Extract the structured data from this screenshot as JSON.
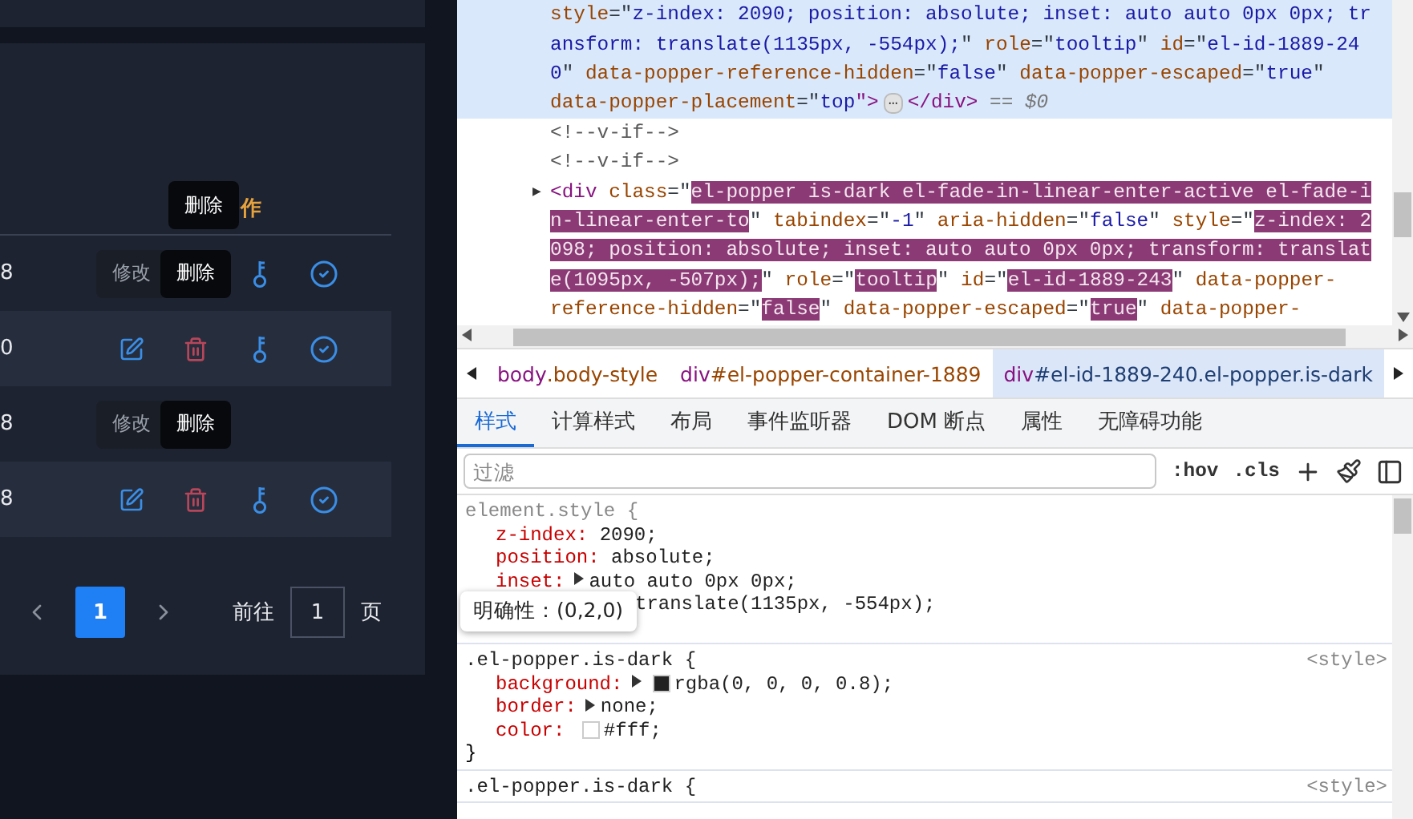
{
  "app": {
    "header": {
      "tooltip": "删除",
      "label": "作"
    },
    "rows": [
      {
        "cell": "8",
        "highlighted": false,
        "actions": [
          {
            "kind": "tooltip",
            "label": "修改",
            "faded": true
          },
          {
            "kind": "tooltip",
            "label": "删除",
            "faded": false
          },
          {
            "kind": "key"
          },
          {
            "kind": "check"
          }
        ]
      },
      {
        "cell": "0",
        "highlighted": true,
        "actions": [
          {
            "kind": "edit"
          },
          {
            "kind": "delete"
          },
          {
            "kind": "key"
          },
          {
            "kind": "check"
          }
        ]
      },
      {
        "cell": "8",
        "highlighted": false,
        "actions": [
          {
            "kind": "tooltip",
            "label": "修改",
            "faded": true
          },
          {
            "kind": "tooltip",
            "label": "删除",
            "faded": false
          }
        ]
      },
      {
        "cell": "8",
        "highlighted": true,
        "actions": [
          {
            "kind": "edit"
          },
          {
            "kind": "delete"
          },
          {
            "kind": "key"
          },
          {
            "kind": "check"
          }
        ]
      }
    ],
    "pagination": {
      "pages": [
        {
          "label": "1",
          "selected": true
        }
      ],
      "goto_label": "前往",
      "goto_value": "1",
      "suffix": "页"
    }
  },
  "devtools": {
    "elements": [
      {
        "selected": true,
        "tokens": [
          {
            "kind": "attr",
            "text": "style"
          },
          {
            "kind": "punct",
            "text": "=\""
          },
          {
            "kind": "value",
            "text": "z-index: 2090; position: absolute; inset: auto auto 0px 0px; tr"
          }
        ]
      },
      {
        "selected": true,
        "tokens": [
          {
            "kind": "value",
            "text": "ansform: translate(1135px, -554px);"
          },
          {
            "kind": "punct",
            "text": "\" "
          },
          {
            "kind": "attr",
            "text": "role"
          },
          {
            "kind": "punct",
            "text": "=\""
          },
          {
            "kind": "value",
            "text": "tooltip"
          },
          {
            "kind": "punct",
            "text": "\" "
          },
          {
            "kind": "attr",
            "text": "id"
          },
          {
            "kind": "punct",
            "text": "=\""
          },
          {
            "kind": "value",
            "text": "el-id-1889-24"
          }
        ]
      },
      {
        "selected": true,
        "tokens": [
          {
            "kind": "value",
            "text": "0"
          },
          {
            "kind": "punct",
            "text": "\" "
          },
          {
            "kind": "attr",
            "text": "data-popper-reference-hidden"
          },
          {
            "kind": "punct",
            "text": "=\""
          },
          {
            "kind": "value",
            "text": "false"
          },
          {
            "kind": "punct",
            "text": "\" "
          },
          {
            "kind": "attr",
            "text": "data-popper-escaped"
          },
          {
            "kind": "punct",
            "text": "=\""
          },
          {
            "kind": "value",
            "text": "true"
          },
          {
            "kind": "punct",
            "text": "\""
          }
        ]
      },
      {
        "selected": true,
        "tokens": [
          {
            "kind": "attr",
            "text": "data-popper-placement"
          },
          {
            "kind": "punct",
            "text": "=\""
          },
          {
            "kind": "value",
            "text": "top"
          },
          {
            "kind": "tag",
            "text": "\">"
          },
          {
            "kind": "ellipsis",
            "text": "…"
          },
          {
            "kind": "tag",
            "text": "</div>"
          },
          {
            "kind": "meta",
            "text": " == $0"
          }
        ]
      },
      {
        "selected": false,
        "tokens": [
          {
            "kind": "comment",
            "text": "<!--v-if-->"
          }
        ]
      },
      {
        "selected": false,
        "tokens": [
          {
            "kind": "comment",
            "text": "<!--v-if-->"
          }
        ]
      },
      {
        "selected": false,
        "arrow": "▶",
        "tokens": [
          {
            "kind": "tag",
            "text": "<div"
          },
          {
            "kind": "attr",
            "text": " class"
          },
          {
            "kind": "punct",
            "text": "=\""
          },
          {
            "kind": "mark",
            "text": "el-popper is-dark el-fade-in-linear-enter-active el-fade-i"
          }
        ]
      },
      {
        "selected": false,
        "tokens": [
          {
            "kind": "mark",
            "text": "n-linear-enter-to"
          },
          {
            "kind": "punct",
            "text": "\" "
          },
          {
            "kind": "attr",
            "text": "tabindex"
          },
          {
            "kind": "punct",
            "text": "=\""
          },
          {
            "kind": "value",
            "text": "-1"
          },
          {
            "kind": "punct",
            "text": "\" "
          },
          {
            "kind": "attr",
            "text": "aria-hidden"
          },
          {
            "kind": "punct",
            "text": "=\""
          },
          {
            "kind": "value",
            "text": "false"
          },
          {
            "kind": "punct",
            "text": "\" "
          },
          {
            "kind": "attr",
            "text": "style"
          },
          {
            "kind": "punct",
            "text": "=\""
          },
          {
            "kind": "mark",
            "text": "z-index: 2"
          }
        ]
      },
      {
        "selected": false,
        "tokens": [
          {
            "kind": "mark",
            "text": "098; position: absolute; inset: auto auto 0px 0px; transform: translat"
          }
        ]
      },
      {
        "selected": false,
        "tokens": [
          {
            "kind": "mark",
            "text": "e(1095px, -507px);"
          },
          {
            "kind": "punct",
            "text": "\" "
          },
          {
            "kind": "attr",
            "text": "role"
          },
          {
            "kind": "punct",
            "text": "=\""
          },
          {
            "kind": "mark",
            "text": "tooltip"
          },
          {
            "kind": "punct",
            "text": "\" "
          },
          {
            "kind": "attr",
            "text": "id"
          },
          {
            "kind": "punct",
            "text": "=\""
          },
          {
            "kind": "mark",
            "text": "el-id-1889-243"
          },
          {
            "kind": "punct",
            "text": "\" "
          },
          {
            "kind": "attr",
            "text": "data-popper-"
          }
        ]
      },
      {
        "selected": false,
        "tokens": [
          {
            "kind": "attr",
            "text": "reference-hidden"
          },
          {
            "kind": "punct",
            "text": "=\""
          },
          {
            "kind": "mark",
            "text": "false"
          },
          {
            "kind": "punct",
            "text": "\" "
          },
          {
            "kind": "attr",
            "text": "data-popper-escaped"
          },
          {
            "kind": "punct",
            "text": "=\""
          },
          {
            "kind": "mark",
            "text": "true"
          },
          {
            "kind": "punct",
            "text": "\" "
          },
          {
            "kind": "attr",
            "text": "data-popper-"
          }
        ]
      }
    ],
    "breadcrumbs": [
      {
        "tag": "body",
        "rest": ".body-style",
        "selected": false
      },
      {
        "tag": "div",
        "rest": "#el-popper-container-1889",
        "selected": false
      },
      {
        "tag": "div",
        "rest": "#el-id-1889-240.el-popper.is-dark",
        "selected": true
      }
    ],
    "tabs": [
      {
        "label": "样式",
        "selected": true
      },
      {
        "label": "计算样式",
        "selected": false
      },
      {
        "label": "布局",
        "selected": false
      },
      {
        "label": "事件监听器",
        "selected": false
      },
      {
        "label": "DOM 断点",
        "selected": false
      },
      {
        "label": "属性",
        "selected": false
      },
      {
        "label": "无障碍功能",
        "selected": false
      }
    ],
    "filter": {
      "placeholder": "过滤",
      "buttons": [
        ":hov",
        ".cls"
      ]
    },
    "rules": [
      {
        "selector": "element.style {",
        "declarations": [
          {
            "name": "z-index:",
            "value": "2090;"
          },
          {
            "name": "position:",
            "value": "absolute;"
          },
          {
            "name": "inset:",
            "expandable": true,
            "value": "auto auto 0px 0px;"
          },
          {
            "value": "translate(1135px, -554px);"
          }
        ]
      },
      {
        "selector": ".el-popper.is-dark {",
        "source": "<style>",
        "declarations": [
          {
            "name": "background:",
            "expandable": true,
            "color": "#222222",
            "value": "rgba(0, 0, 0, 0.8);"
          },
          {
            "name": "border:",
            "expandable": true,
            "value": "none;"
          },
          {
            "name": "color:",
            "color": "#ffffff",
            "value": "#fff;"
          }
        ],
        "close": "}"
      },
      {
        "selector": ".el-popper.is-dark {",
        "source": "<style>"
      }
    ],
    "specificity_tooltip": "明确性：(0,2,0)"
  }
}
